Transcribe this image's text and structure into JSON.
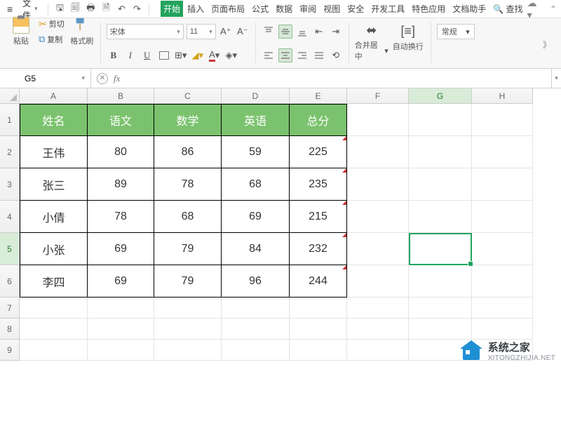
{
  "menu": {
    "file": "文件",
    "start": "开始",
    "insert": "插入",
    "layout": "页面布局",
    "formula": "公式",
    "data": "数据",
    "review": "审阅",
    "view": "视图",
    "safe": "安全",
    "dev": "开发工具",
    "special": "特色应用",
    "help": "文档助手",
    "search": "查找"
  },
  "ribbon": {
    "paste": "粘贴",
    "cut": "剪切",
    "copy": "复制",
    "brush": "格式刷",
    "font": "宋体",
    "size": "11",
    "merge": "合并居中",
    "wrap": "自动换行",
    "numfmt": "常规"
  },
  "cell": {
    "ref": "G5"
  },
  "cols": [
    "A",
    "B",
    "C",
    "D",
    "E",
    "F",
    "G",
    "H"
  ],
  "rows": [
    "1",
    "2",
    "3",
    "4",
    "5",
    "6",
    "7",
    "8",
    "9"
  ],
  "table": {
    "hdr": [
      "姓名",
      "语文",
      "数学",
      "英语",
      "总分"
    ],
    "r1": [
      "王伟",
      "80",
      "86",
      "59",
      "225"
    ],
    "r2": [
      "张三",
      "89",
      "78",
      "68",
      "235"
    ],
    "r3": [
      "小倩",
      "78",
      "68",
      "69",
      "215"
    ],
    "r4": [
      "小张",
      "69",
      "79",
      "84",
      "232"
    ],
    "r5": [
      "李四",
      "69",
      "79",
      "96",
      "244"
    ]
  },
  "wm": {
    "t1": "系统之家",
    "t2": "XITONGZHIJIA.NET"
  }
}
